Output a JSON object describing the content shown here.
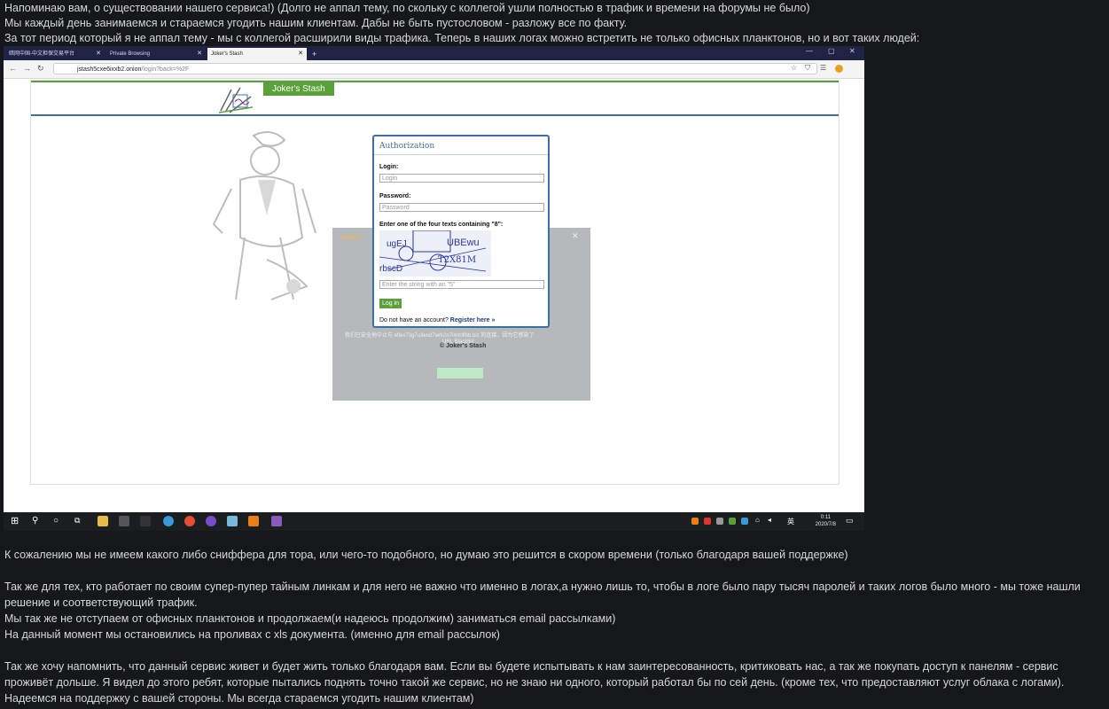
{
  "paragraphs_top": [
    "Напоминаю вам, о существовании нашего сервиса!) (Долго не аппал тему, по скольку с коллегой ушли полностью в трафик и времени на форумы не было)",
    "Мы каждый день занимаемся и стараемся угодить нашим клиентам. Дабы не быть пустословом - разложу все по факту.",
    "За тот период который я не аппал тему - мы с коллегой расширили виды трафика. Теперь в наших логах можно встретить не только офисных планктонов, но и вот таких людей:"
  ],
  "browser": {
    "tabs": [
      "暗网中国-中文担保交易平台",
      "Private Browsing",
      "Joker's Stash"
    ],
    "new_tab": "+",
    "url_host": "jstash5cxe6ixxb2.onion",
    "url_path": "/login?back=%2F"
  },
  "site": {
    "brand": "Joker's Stash",
    "auth_title": "Authorization",
    "login_label": "Login:",
    "login_placeholder": "Login",
    "password_label": "Password:",
    "password_placeholder": "Password",
    "captcha_prompt": "Enter one of the four texts containing \"8\":",
    "captcha_texts": [
      "ugEJ",
      "UBEwu",
      "T2X81M",
      "rbscD"
    ],
    "captcha_placeholder": "Enter the string with an \"5\"",
    "login_button": "Log in",
    "register_prefix": "Do not have an account?",
    "register_link": "Register here »",
    "copyright": "© Joker's Stash",
    "overlay_title": "avast!",
    "overlay_line1": "我们已安全地中止与 eflex73g7u3eod7wrk2n7i4rtrllfbb.biz 的连接，因为它感染了",
    "overlay_line2": "URL:Blacklist"
  },
  "taskbar": {
    "time": "0:11",
    "date": "2020/7/8",
    "lang": "英"
  },
  "paragraphs_bottom": [
    "К сожалению мы не имеем какого либо сниффера для тора, или чего-то подобного, но думаю это решится в скором времени (только благодаря вашей поддержке)",
    "Так же для тех, кто работает по своим супер-пупер тайным линкам и для него не важно что именно в логах,а нужно лишь то, чтобы в логе было пару тысяч паролей и таких логов было много - мы тоже нашли решение и соответствующий трафик.",
    "Мы так же не отступаем от офисных планктонов и продолжаем(и надеюсь продолжим) заниматься email рассылками)",
    "На данный момент мы остановились на проливах с xls документа. (именно для email рассылок)",
    "Так же хочу напомнить, что данный сервис живет и будет жить только благодаря вам. Если вы будете испытывать к нам заинтересованность, критиковать нас, а так же покупать доступ к панелям - сервис проживёт дольше. Я видел до этого ребят, которые пытались поднять точно такой же сервис, но не знаю ни одного, который работал бы по сей день. (кроме тех, что предоставляют услуг облака с логами). Надеемся на поддержку с вашей стороны. Мы всегда стараемся угодить нашим клиентам)"
  ]
}
